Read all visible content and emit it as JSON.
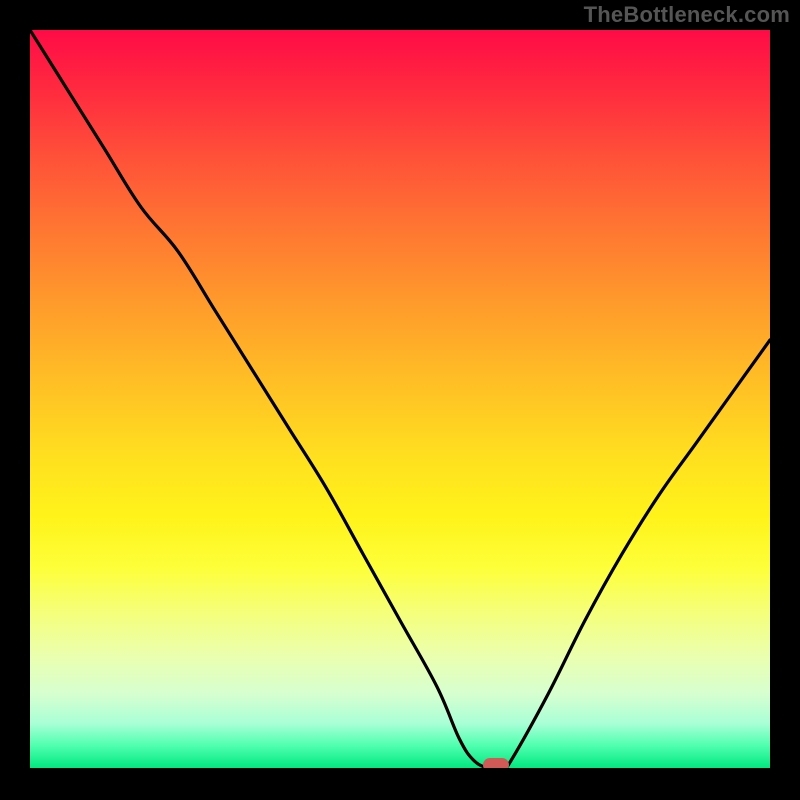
{
  "attribution": "TheBottleneck.com",
  "chart_data": {
    "type": "line",
    "title": "",
    "xlabel": "",
    "ylabel": "",
    "x": [
      0,
      5,
      10,
      15,
      20,
      25,
      30,
      35,
      40,
      45,
      50,
      55,
      58,
      60,
      62,
      64,
      65,
      70,
      75,
      80,
      85,
      90,
      95,
      100
    ],
    "values": [
      100,
      92,
      84,
      76,
      70,
      62,
      54,
      46,
      38,
      29,
      20,
      11,
      4,
      1,
      0,
      0,
      1,
      10,
      20,
      29,
      37,
      44,
      51,
      58
    ],
    "xlim": [
      0,
      100
    ],
    "ylim": [
      0,
      100
    ],
    "minimum_x": 63,
    "minimum_y": 0,
    "note": "x and y are normalized 0-100 across the visible plot area; y=0 is the bottom (green), y=100 is the top (red). Curve represents bottleneck percentage; it reaches ~0 near x≈63."
  },
  "colors": {
    "line": "#000000",
    "marker": "#d15a57",
    "gradient_top": "#ff0b46",
    "gradient_bottom": "#00e97f"
  }
}
